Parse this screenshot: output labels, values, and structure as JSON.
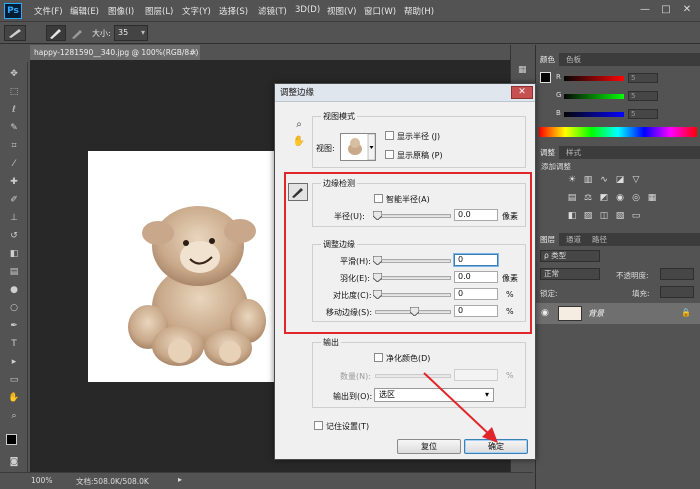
{
  "app": {
    "logo": "Ps",
    "menu": [
      "文件(F)",
      "编辑(E)",
      "图像(I)",
      "图层(L)",
      "文字(Y)",
      "选择(S)",
      "滤镜(T)",
      "3D(D)",
      "视图(V)",
      "窗口(W)",
      "帮助(H)"
    ],
    "window_controls": [
      "—",
      "□",
      "✕"
    ]
  },
  "options_bar": {
    "size_label": "大小:",
    "size_value": "35"
  },
  "document": {
    "tab_title": "happy-1281590__340.jpg @ 100%(RGB/8#)",
    "tab_close": "×"
  },
  "status_bar": {
    "zoom": "100%",
    "doc_info": "文档:508.0K/508.0K"
  },
  "panels": {
    "color_tabs": [
      "颜色",
      "色板"
    ],
    "rgb_labels": [
      "R",
      "G",
      "B"
    ],
    "rgb_values": [
      "5",
      "5",
      "5"
    ],
    "adjust_tabs": [
      "调整",
      "样式"
    ],
    "adjust_title": "添加调整",
    "layer_tabs": [
      "图层",
      "通道",
      "路径"
    ],
    "kind_value": "ρ 类型",
    "blend_mode": "正常",
    "opacity_label": "不透明度:",
    "lock_label": "锁定:",
    "fill_label": "填充:",
    "layer_name": "背景",
    "lock_icon": "🔒"
  },
  "dialog": {
    "title": "调整边缘",
    "close_glyph": "✕",
    "view_mode": {
      "group_label": "视图模式",
      "view_label": "视图:",
      "show_radius": "显示半径 (J)",
      "show_original": "显示原稿 (P)"
    },
    "edge_detection": {
      "group_label": "边缘检测",
      "smart_radius": "智能半径(A)",
      "radius_label": "半径(U):",
      "radius_value": "0.0",
      "radius_unit": "像素"
    },
    "adjust_edge": {
      "group_label": "调整边缘",
      "smooth_label": "平滑(H):",
      "smooth_value": "0",
      "feather_label": "羽化(E):",
      "feather_value": "0.0",
      "feather_unit": "像素",
      "contrast_label": "对比度(C):",
      "contrast_value": "0",
      "contrast_unit": "%",
      "shift_label": "移动边缘(S):",
      "shift_value": "0",
      "shift_unit": "%"
    },
    "output": {
      "group_label": "输出",
      "decontaminate": "净化颜色(D)",
      "amount_label": "数量(N):",
      "amount_unit": "%",
      "output_to_label": "输出到(O):",
      "output_to_value": "选区"
    },
    "remember": "记住设置(T)",
    "reset_button": "复位",
    "ok_button": "确定"
  },
  "colors": {
    "highlight_red": "#e0262b",
    "ok_border": "#3c7fb1"
  }
}
